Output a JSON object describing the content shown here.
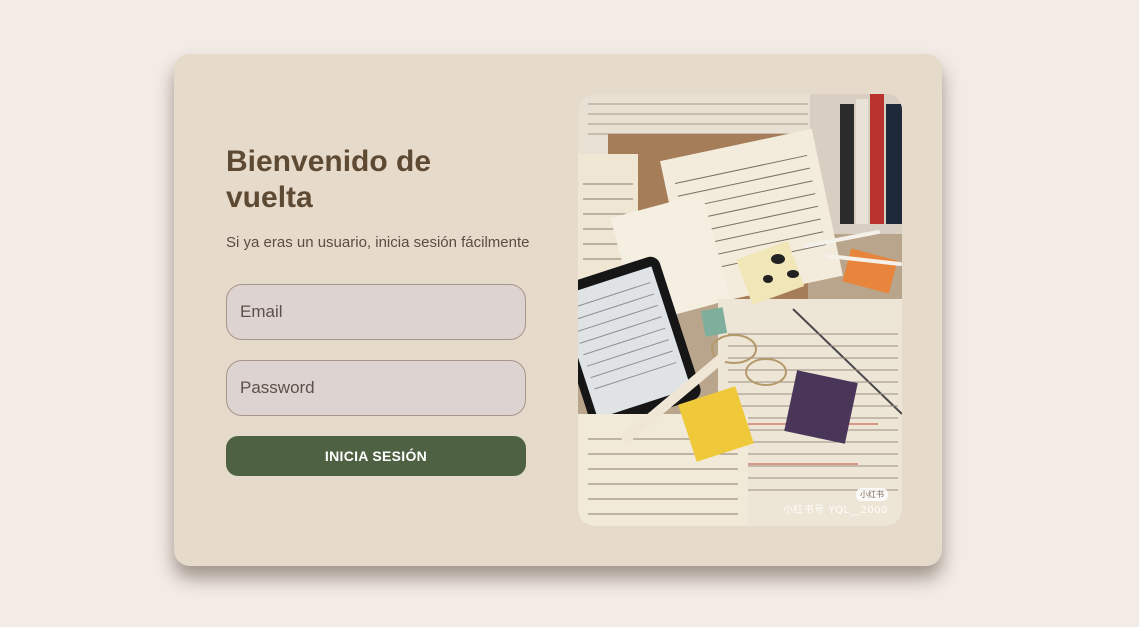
{
  "login": {
    "title": "Bienvenido de vuelta",
    "subtitle": "Si ya eras un usuario, inicia sesión fácilmente",
    "email_placeholder": "Email",
    "password_placeholder": "Password",
    "submit_label": "INICIA SESIÓN"
  },
  "image": {
    "alt": "Desk with notebooks, tablet, glasses and sticky notes",
    "watermark_badge": "小红书",
    "watermark_text": "小红书号 YQL__2000"
  },
  "colors": {
    "page_background": "#f3ebe6",
    "card_background": "#e6dacb",
    "title": "#5e4a33",
    "button": "#4e6142",
    "input_background": "#ddd3d0"
  }
}
